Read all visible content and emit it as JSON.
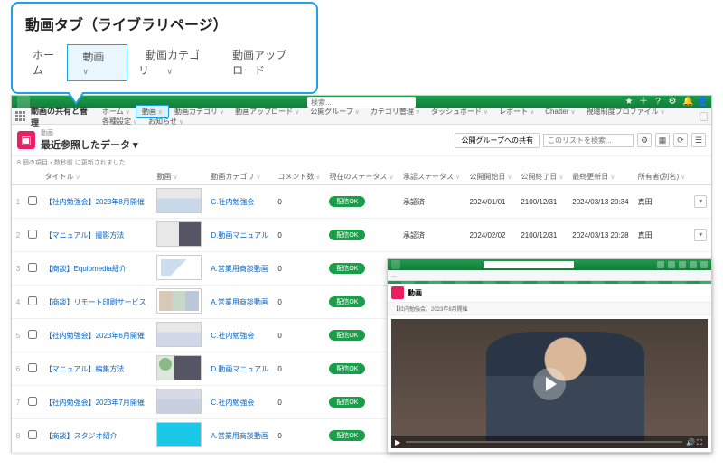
{
  "callout": {
    "title": "動画タブ（ライブラリページ）",
    "nav": {
      "home": "ホーム",
      "video": "動画",
      "category": "動画カテゴリ",
      "upload": "動画アップロード"
    }
  },
  "topbar": {
    "search_placeholder": "検索..."
  },
  "tabs": {
    "app_name": "動画の共有と管理",
    "items": [
      "ホーム",
      "動画",
      "動画カテゴリ",
      "動画アップロード",
      "公開グループ",
      "カテゴリ管理",
      "ダッシュボード",
      "レポート",
      "Chatter",
      "視聴制度プロファイル",
      "各種設定",
      "お知らせ"
    ],
    "active_index": 1
  },
  "list": {
    "object_sub": "動画",
    "object_title": "最近参照したデータ",
    "share_btn": "公開グループへの共有",
    "list_search_ph": "このリストを検索...",
    "subnote": "8 個の項目・数秒前 に更新されました",
    "columns": [
      "",
      "",
      "タイトル",
      "動画",
      "動画カテゴリ",
      "コメント数",
      "現在のステータス",
      "承認ステータス",
      "公開開始日",
      "公開終了日",
      "最終更新日",
      "所有者(別名)",
      ""
    ],
    "rows": [
      {
        "idx": "1",
        "title": "【社内勉強会】2023年8月開催",
        "thumb": "t1",
        "cat": "C.社内勉強会",
        "comments": "0",
        "status": "配信OK",
        "approve": "承認済",
        "start": "2024/01/01",
        "end": "2100/12/31",
        "updated": "2024/03/13 20:34",
        "owner": "真田"
      },
      {
        "idx": "2",
        "title": "【マニュアル】撮影方法",
        "thumb": "t2",
        "cat": "D.動画マニュアル",
        "comments": "0",
        "status": "配信OK",
        "approve": "承認済",
        "start": "2024/02/02",
        "end": "2100/12/31",
        "updated": "2024/03/13 20:28",
        "owner": "真田"
      },
      {
        "idx": "3",
        "title": "【商談】Equipmedia紹介",
        "thumb": "t3",
        "cat": "A.営業用商談動画",
        "comments": "0",
        "status": "配信OK",
        "approve": "承認済",
        "start": "2023/12/01",
        "end": "2100/12/31",
        "updated": "2024/03/13 20:34",
        "owner": "真田"
      },
      {
        "idx": "4",
        "title": "【商談】リモート印刷サービス",
        "thumb": "t4",
        "cat": "A.営業用商談動画",
        "comments": "0",
        "status": "配信OK",
        "approve": "",
        "start": "",
        "end": "",
        "updated": "",
        "owner": ""
      },
      {
        "idx": "5",
        "title": "【社内勉強会】2023年6月開催",
        "thumb": "t5",
        "cat": "C.社内勉強会",
        "comments": "0",
        "status": "配信OK",
        "approve": "",
        "start": "",
        "end": "",
        "updated": "",
        "owner": ""
      },
      {
        "idx": "6",
        "title": "【マニュアル】編集方法",
        "thumb": "t6",
        "cat": "D.動画マニュアル",
        "comments": "0",
        "status": "配信OK",
        "approve": "",
        "start": "",
        "end": "",
        "updated": "",
        "owner": ""
      },
      {
        "idx": "7",
        "title": "【社内勉強会】2023年7月開催",
        "thumb": "t7",
        "cat": "C.社内勉強会",
        "comments": "0",
        "status": "配信OK",
        "approve": "",
        "start": "",
        "end": "",
        "updated": "",
        "owner": ""
      },
      {
        "idx": "8",
        "title": "【商談】スタジオ紹介",
        "thumb": "t8",
        "cat": "A.営業用商談動画",
        "comments": "0",
        "status": "配信OK",
        "approve": "",
        "start": "",
        "end": "",
        "updated": "",
        "owner": ""
      }
    ]
  },
  "detail": {
    "object": "動画",
    "breadcrumb": "【社内勉強会】2023年8月開催"
  }
}
